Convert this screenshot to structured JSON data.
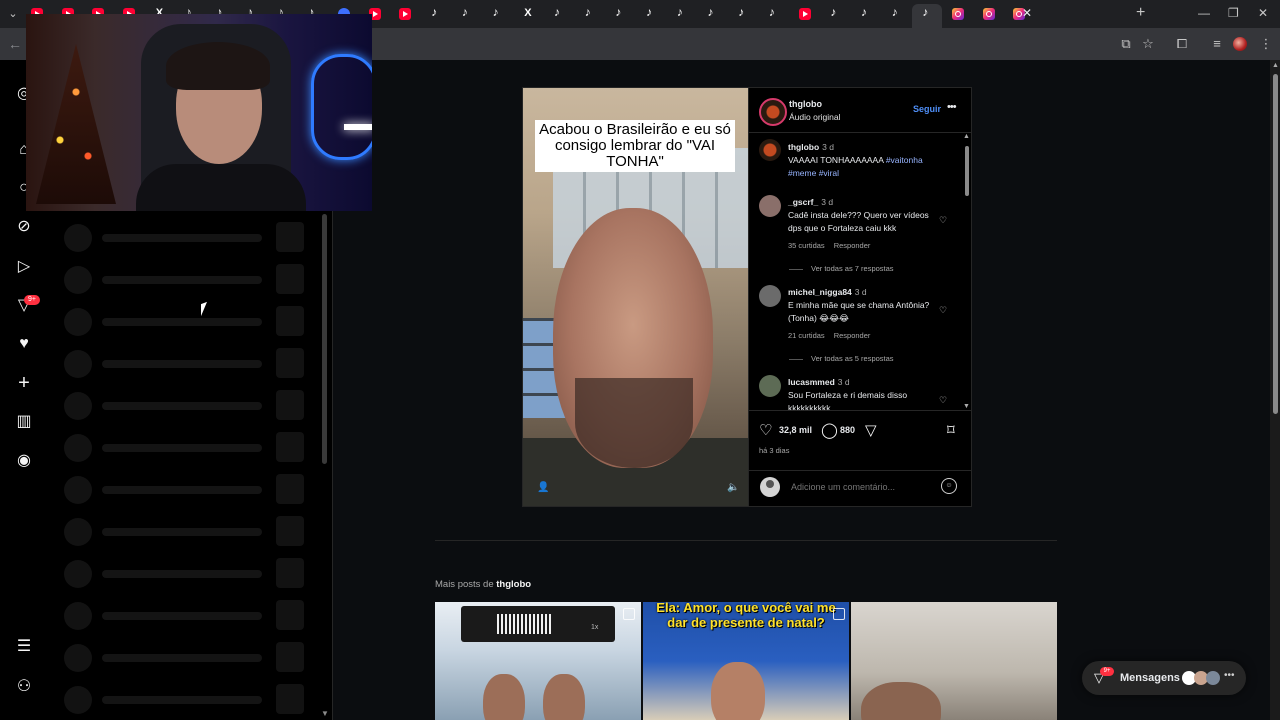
{
  "browser": {
    "tab_favicons": [
      "yt",
      "yt",
      "yt",
      "yt",
      "x",
      "tt",
      "tt",
      "tt",
      "tt",
      "tt",
      "discord",
      "yt",
      "yt",
      "tt",
      "tt",
      "tt",
      "x",
      "tt",
      "tt",
      "tt",
      "tt",
      "tt",
      "tt",
      "tt",
      "tt",
      "yt",
      "tt",
      "tt",
      "tt",
      "tt",
      "ig",
      "ig",
      "ig"
    ],
    "active_tab_index": 29,
    "icons": {
      "tab_menu": "chevron-down-icon",
      "new_tab": "plus-icon",
      "back": "back-arrow-icon",
      "install_app": "install-app-icon",
      "bookmark": "star-icon",
      "extensions": "puzzle-icon",
      "media": "media-controls-icon",
      "profile": "profile-avatar-icon",
      "menu": "kebab-menu-icon"
    }
  },
  "rail": {
    "items": [
      "instagram-icon",
      "home-icon",
      "search-icon",
      "explore-icon",
      "reels-icon",
      "notifications-icon",
      "heart-icon",
      "create-icon",
      "dashboard-icon",
      "profile-icon"
    ],
    "notifications_badge": "9+",
    "bottom": [
      "more-menu-icon",
      "meta-icon"
    ]
  },
  "post": {
    "overlay_caption": "Acabou o Brasileirão e eu só consigo lembrar do \"VAI TONHA\"",
    "username": "thglobo",
    "audio": "Áudio original",
    "follow_label": "Seguir",
    "caption": {
      "user": "thglobo",
      "time": "3 d",
      "text": "VAAAAI TONHAAAAAAA",
      "tags": "#vaitonha #meme #viral"
    },
    "comments": [
      {
        "user": "_gscrf_",
        "time": "3 d",
        "text": "Cadê insta dele??? Quero ver vídeos dps que o Fortaleza caiu kkk",
        "likes": "35 curtidas",
        "reply": "Responder",
        "replies": "Ver todas as 7 respostas"
      },
      {
        "user": "michel_nigga84",
        "time": "3 d",
        "text": "E minha mãe que se chama Antônia?(Tonha) 😂😂😂",
        "likes": "21 curtidas",
        "reply": "Responder",
        "replies": "Ver todas as 5 respostas"
      },
      {
        "user": "lucasmmed",
        "time": "3 d",
        "text": "Sou Fortaleza e ri demais disso kkkkkkkkkk"
      }
    ],
    "likes_count": "32,8 mil",
    "comments_count": "880",
    "date": "há 3 dias",
    "add_comment_placeholder": "Adicione um comentário..."
  },
  "more_posts": {
    "prefix": "Mais posts de",
    "user": "thglobo",
    "thumb2_caption": "Ela: Amor, o que você vai me dar de presente de natal?",
    "thumb1_speed": "1x"
  },
  "messages": {
    "label": "Mensagens",
    "badge": "9+"
  },
  "colors": {
    "accent": "#4f8ff7",
    "badge": "#ff3040",
    "background": "#000000"
  }
}
